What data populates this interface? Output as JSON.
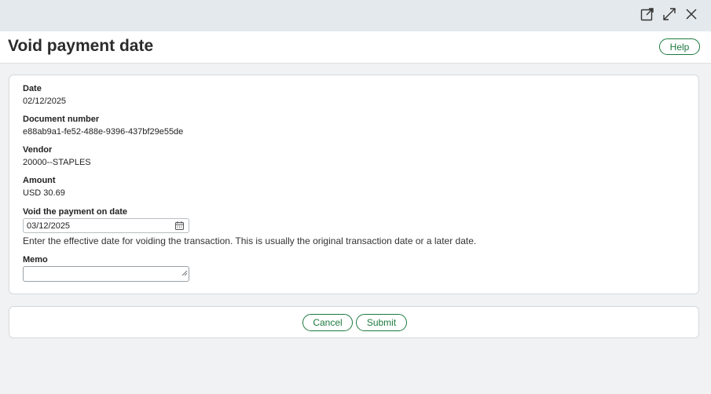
{
  "window": {
    "icons": [
      "open-in-new-window-icon",
      "expand-icon",
      "close-icon"
    ]
  },
  "header": {
    "title": "Void payment date",
    "help_label": "Help"
  },
  "fields": {
    "date": {
      "label": "Date",
      "value": "02/12/2025"
    },
    "document_number": {
      "label": "Document number",
      "value": "e88ab9a1-fe52-488e-9396-437bf29e55de"
    },
    "vendor": {
      "label": "Vendor",
      "value": "20000--STAPLES"
    },
    "amount": {
      "label": "Amount",
      "value": "USD 30.69"
    },
    "void_date": {
      "label": "Void the payment on date",
      "value": "03/12/2025",
      "hint": "Enter the effective date for voiding the transaction. This is usually the original transaction date or a later date."
    },
    "memo": {
      "label": "Memo",
      "value": ""
    }
  },
  "footer": {
    "cancel_label": "Cancel",
    "submit_label": "Submit"
  },
  "colors": {
    "accent": "#1d7a3f",
    "topbar": "#e4e9ed",
    "background": "#f1f2f3"
  }
}
